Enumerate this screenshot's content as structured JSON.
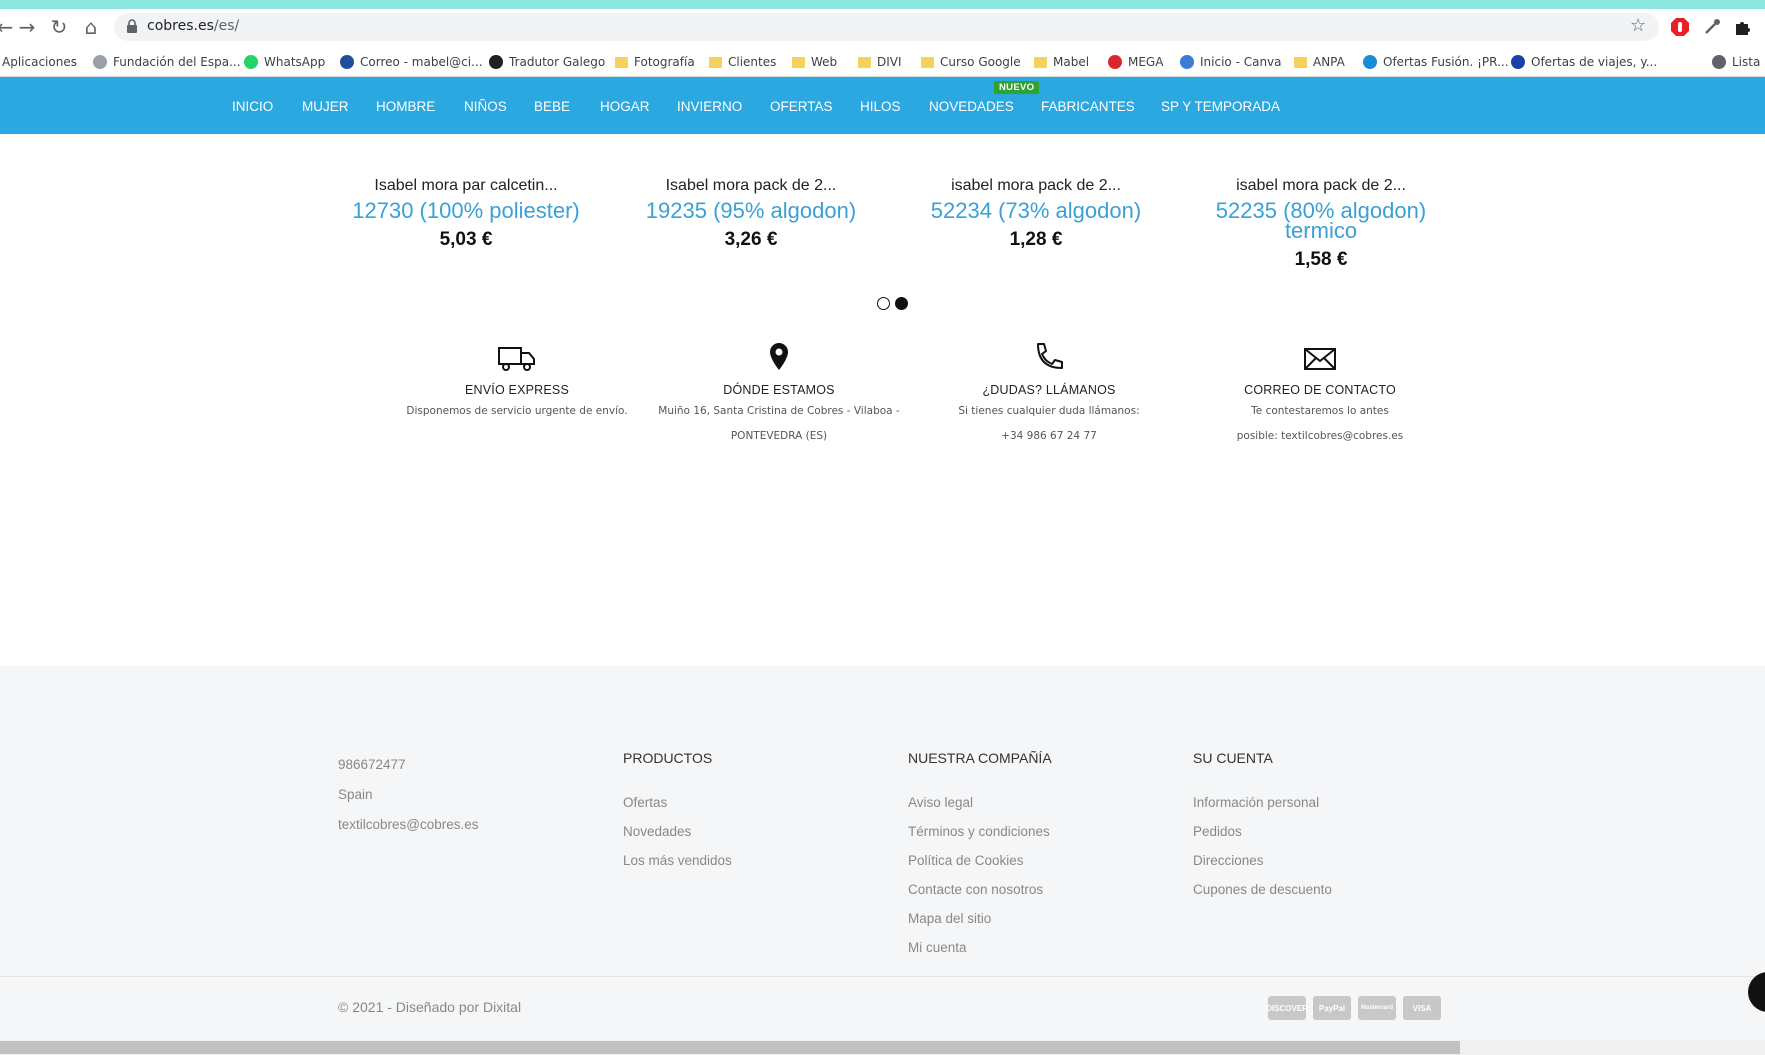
{
  "browser": {
    "url_host": "cobres.es",
    "url_path": "/es/",
    "bookmarks": [
      {
        "label": "Aplicaciones",
        "icon": "apps-grid-icon"
      },
      {
        "label": "Fundación del Espa...",
        "icon": "site-favicon-icon"
      },
      {
        "label": "WhatsApp",
        "icon": "whatsapp-icon"
      },
      {
        "label": "Correo - mabel@ci...",
        "icon": "mail-favicon-icon"
      },
      {
        "label": "Tradutor Galego",
        "icon": "translate-icon"
      },
      {
        "label": "Fotografía",
        "icon": "folder-icon"
      },
      {
        "label": "Clientes",
        "icon": "folder-icon"
      },
      {
        "label": "Web",
        "icon": "folder-icon"
      },
      {
        "label": "DIVI",
        "icon": "folder-icon"
      },
      {
        "label": "Curso Google",
        "icon": "folder-icon"
      },
      {
        "label": "Mabel",
        "icon": "folder-icon"
      },
      {
        "label": "MEGA",
        "icon": "mega-icon"
      },
      {
        "label": "Inicio - Canva",
        "icon": "canva-icon"
      },
      {
        "label": "ANPA",
        "icon": "folder-icon"
      },
      {
        "label": "Ofertas Fusión. ¡PR...",
        "icon": "movistar-icon"
      },
      {
        "label": "Ofertas de viajes, y...",
        "icon": "travel-favicon-icon"
      },
      {
        "label": "Lista",
        "icon": "reading-list-icon"
      }
    ]
  },
  "nav": {
    "items": [
      "INICIO",
      "MUJER",
      "HOMBRE",
      "NIÑOS",
      "BEBE",
      "HOGAR",
      "INVIERNO",
      "OFERTAS",
      "HILOS",
      "NOVEDADES",
      "FABRICANTES",
      "SP Y TEMPORADA"
    ],
    "badge": "NUEVO"
  },
  "products": [
    {
      "name": "Isabel mora par calcetin...",
      "sub": "12730 (100% poliester)",
      "price": "5,03 €"
    },
    {
      "name": "Isabel mora pack de 2...",
      "sub": "19235 (95% algodon)",
      "price": "3,26 €"
    },
    {
      "name": "isabel mora pack de 2...",
      "sub": "52234 (73% algodon)",
      "price": "1,28 €"
    },
    {
      "name": "isabel mora pack de 2...",
      "sub": "52235 (80% algodon) termico",
      "price": "1,58 €"
    }
  ],
  "carousel": {
    "active_page": 2,
    "total_pages": 2
  },
  "info": [
    {
      "icon": "truck-icon",
      "title": "ENVÍO EXPRESS",
      "lines": [
        "Disponemos de servicio urgente de envío."
      ]
    },
    {
      "icon": "location-pin-icon",
      "title": "DÓNDE ESTAMOS",
      "lines": [
        "Muiño 16, Santa Cristina de Cobres - Vilaboa -",
        "PONTEVEDRA (ES)"
      ]
    },
    {
      "icon": "phone-icon",
      "title": "¿DUDAS? LLÁMANOS",
      "lines": [
        "Si tienes cualquier duda llámanos:",
        "+34 986 67 24 77"
      ]
    },
    {
      "icon": "envelope-icon",
      "title": "CORREO DE CONTACTO",
      "lines": [
        "Te contestaremos lo antes",
        "posible: textilcobres@cobres.es"
      ]
    }
  ],
  "footer": {
    "contact": [
      "986672477",
      "Spain",
      "textilcobres@cobres.es"
    ],
    "products_title": "PRODUCTOS",
    "products_links": [
      "Ofertas",
      "Novedades",
      "Los más vendidos"
    ],
    "company_title": "NUESTRA COMPAÑÍA",
    "company_links": [
      "Aviso legal",
      "Términos y condiciones",
      "Política de Cookies",
      "Contacte con nosotros",
      "Mapa del sitio",
      "Mi cuenta"
    ],
    "account_title": "SU CUENTA",
    "account_links": [
      "Información personal",
      "Pedidos",
      "Direcciones",
      "Cupones de descuento"
    ],
    "copyright": "© 2021 - Diseñado por Dixital",
    "payment_methods": [
      "DISCOVER",
      "PayPal",
      "Mastercard",
      "VISA"
    ]
  },
  "colors": {
    "nav_bg": "#2aa8df",
    "accent": "#3aa0d6",
    "badge": "#2fa32f",
    "footer_bg": "#f5f6f7"
  }
}
